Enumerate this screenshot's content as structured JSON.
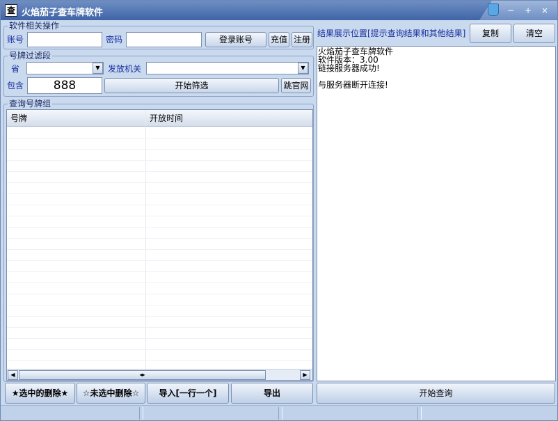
{
  "window": {
    "title": "火焰茄子查车牌软件",
    "icon_char": "查",
    "controls": [
      "−",
      "+",
      "×"
    ]
  },
  "software_ops": {
    "group_label": "软件相关操作",
    "account_label": "账号",
    "account_value": "",
    "password_label": "密码",
    "password_value": "",
    "login_button": "登录账号",
    "recharge_button": "充值",
    "register_button": "注册"
  },
  "filter": {
    "group_label": "号牌过滤段",
    "province_label": "省",
    "province_value": "",
    "issuer_label": "发放机关",
    "issuer_value": "",
    "contains_label": "包含",
    "contains_value": "888",
    "start_filter_button": "开始筛选",
    "official_site_button": "跳官网"
  },
  "plate_group": {
    "group_label": "查询号牌组",
    "columns": [
      "号牌",
      "开放时间"
    ],
    "rows": []
  },
  "result": {
    "header_label": "结果展示位置[提示查询结果和其他结果]",
    "copy_button": "复制",
    "clear_button": "清空",
    "lines": [
      "火焰茄子查车牌软件",
      "软件版本：3.00",
      "链接服务器成功!",
      "",
      "与服务器断开连接!"
    ]
  },
  "bottom_buttons": {
    "delete_selected": "★选中的删除★",
    "delete_unselected": "☆未选中删除☆",
    "import": "导入[一行一个]",
    "export": "导出",
    "start_query": "开始查询"
  },
  "icons": {
    "dropdown": "chevron-down-icon",
    "scroll_left": "arrow-left-icon",
    "scroll_right": "arrow-right-icon",
    "cup": "cup-icon"
  },
  "colors": {
    "window_bg": "#c9d9ee",
    "titlebar": "#3f64a6",
    "label_blue": "#1a2fa0"
  }
}
